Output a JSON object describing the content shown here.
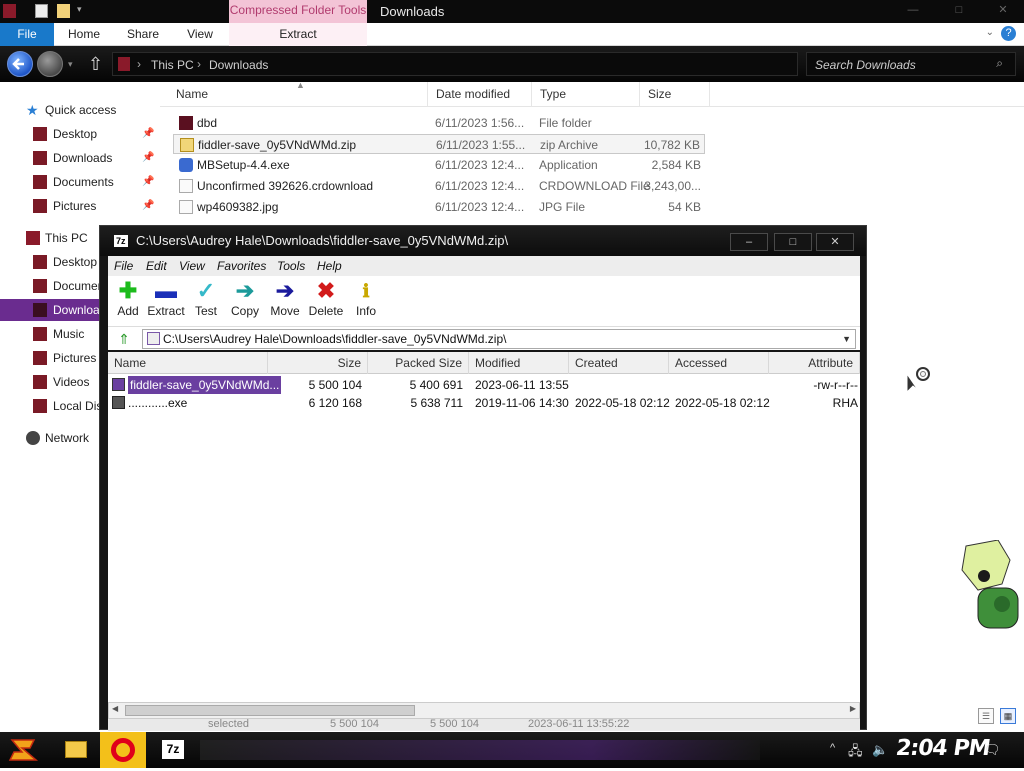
{
  "explorer": {
    "title": "Downloads",
    "context_tab": "Compressed Folder Tools",
    "ribbon_tabs": [
      "File",
      "Home",
      "Share",
      "View"
    ],
    "extract_tab": "Extract",
    "breadcrumb": [
      "This PC",
      "Downloads"
    ],
    "search_placeholder": "Search Downloads",
    "columns": [
      "Name",
      "Date modified",
      "Type",
      "Size"
    ],
    "files": [
      {
        "name": "dbd",
        "date": "6/11/2023 1:56...",
        "type": "File folder",
        "size": ""
      },
      {
        "name": "fiddler-save_0y5VNdWMd.zip",
        "date": "6/11/2023 1:55...",
        "type": "zip Archive",
        "size": "10,782 KB"
      },
      {
        "name": "MBSetup-4.4.exe",
        "date": "6/11/2023 12:4...",
        "type": "Application",
        "size": "2,584 KB"
      },
      {
        "name": "Unconfirmed 392626.crdownload",
        "date": "6/11/2023 12:4...",
        "type": "CRDOWNLOAD File",
        "size": "3,243,00..."
      },
      {
        "name": "wp4609382.jpg",
        "date": "6/11/2023 12:4...",
        "type": "JPG File",
        "size": "54 KB"
      }
    ],
    "nav": {
      "quick_access": "Quick access",
      "qa_items": [
        "Desktop",
        "Downloads",
        "Documents",
        "Pictures"
      ],
      "this_pc": "This PC",
      "pc_items": [
        "Desktop",
        "Documents",
        "Downloads",
        "Music",
        "Pictures",
        "Videos",
        "Local Disk"
      ],
      "network": "Network"
    }
  },
  "zip_window": {
    "title": "C:\\Users\\Audrey Hale\\Downloads\\fiddler-save_0y5VNdWMd.zip\\",
    "app_badge": "7z",
    "menu": [
      "File",
      "Edit",
      "View",
      "Favorites",
      "Tools",
      "Help"
    ],
    "toolbar": [
      "Add",
      "Extract",
      "Test",
      "Copy",
      "Move",
      "Delete",
      "Info"
    ],
    "address": "C:\\Users\\Audrey Hale\\Downloads\\fiddler-save_0y5VNdWMd.zip\\",
    "columns": [
      "Name",
      "Size",
      "Packed Size",
      "Modified",
      "Created",
      "Accessed",
      "Attribute"
    ],
    "rows": [
      {
        "name": "fiddler-save_0y5VNdWMd...",
        "size": "5 500 104",
        "packed": "5 400 691",
        "modified": "2023-06-11 13:55",
        "created": "",
        "accessed": "",
        "attr": "-rw-r--r--"
      },
      {
        "name": "............exe",
        "size": "6 120 168",
        "packed": "5 638 711",
        "modified": "2019-11-06 14:30",
        "created": "2022-05-18 02:12",
        "accessed": "2022-05-18 02:12",
        "attr": "RHA"
      }
    ],
    "status": [
      "selected",
      "5 500 104",
      "5 500 104",
      "2023-06-11 13:55:22"
    ]
  },
  "taskbar": {
    "clock": "2:04 PM",
    "app_7z": "7z"
  },
  "colors": {
    "accent_purple": "#6a2c8f",
    "file_tab_blue": "#1979ca",
    "context_pink": "#f3c4d6"
  }
}
